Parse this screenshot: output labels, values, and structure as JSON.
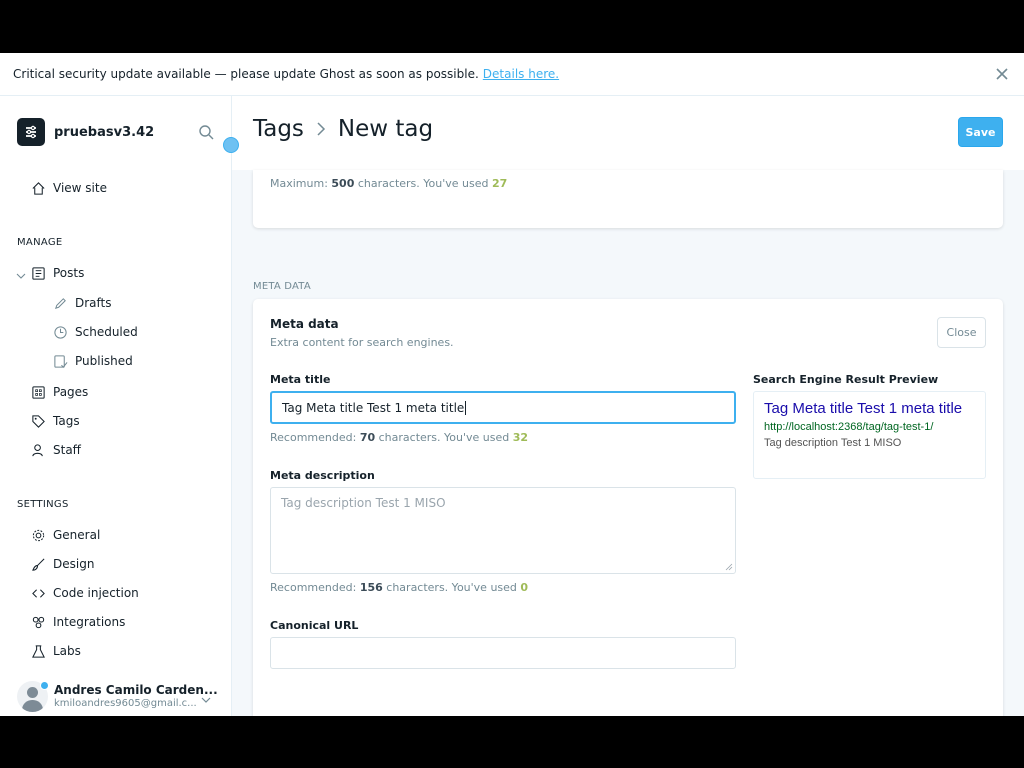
{
  "banner": {
    "text": "Critical security update available — please update Ghost as soon as possible.",
    "link": "Details here."
  },
  "sidebar": {
    "site_name": "pruebasv3.42",
    "view_site": "View site",
    "manage_label": "MANAGE",
    "manage_items": [
      {
        "label": "Posts",
        "icon": "posts-icon"
      },
      {
        "label": "Drafts",
        "icon": "pencil-icon"
      },
      {
        "label": "Scheduled",
        "icon": "clock-icon"
      },
      {
        "label": "Published",
        "icon": "published-icon"
      },
      {
        "label": "Pages",
        "icon": "pages-icon"
      },
      {
        "label": "Tags",
        "icon": "tag-icon"
      },
      {
        "label": "Staff",
        "icon": "staff-icon"
      }
    ],
    "settings_label": "SETTINGS",
    "settings_items": [
      {
        "label": "General",
        "icon": "gear-icon"
      },
      {
        "label": "Design",
        "icon": "brush-icon"
      },
      {
        "label": "Code injection",
        "icon": "code-icon"
      },
      {
        "label": "Integrations",
        "icon": "integrations-icon"
      },
      {
        "label": "Labs",
        "icon": "flask-icon"
      }
    ],
    "user": {
      "name": "Andres Camilo Carden...",
      "email": "kmiloandres9605@gmail.c..."
    }
  },
  "header": {
    "crumb_parent": "Tags",
    "crumb_current": "New tag",
    "save_label": "Save"
  },
  "top_card": {
    "hint_prefix": "Maximum:",
    "hint_max": "500",
    "hint_mid": "characters. You've used",
    "hint_used": "27"
  },
  "meta": {
    "section_label": "META DATA",
    "title": "Meta data",
    "subtitle": "Extra content for search engines.",
    "close_label": "Close",
    "meta_title_label": "Meta title",
    "meta_title_value": "Tag Meta title Test 1 meta title",
    "meta_title_hint_prefix": "Recommended:",
    "meta_title_hint_rec": "70",
    "meta_title_hint_mid": "characters. You've used",
    "meta_title_hint_used": "32",
    "meta_desc_label": "Meta description",
    "meta_desc_placeholder": "Tag description Test 1 MISO",
    "meta_desc_hint_prefix": "Recommended:",
    "meta_desc_hint_rec": "156",
    "meta_desc_hint_mid": "characters. You've used",
    "meta_desc_hint_used": "0",
    "canonical_label": "Canonical URL",
    "canonical_value": "",
    "serp_label": "Search Engine Result Preview",
    "serp_title": "Tag Meta title Test 1 meta title",
    "serp_url": "http://localhost:2368/tag/tag-test-1/",
    "serp_desc": "Tag description Test 1 MISO"
  },
  "colors": {
    "accent": "#3eb0ef",
    "text": "#15212a",
    "muted": "#738a94",
    "used_green": "#9fbb58"
  }
}
